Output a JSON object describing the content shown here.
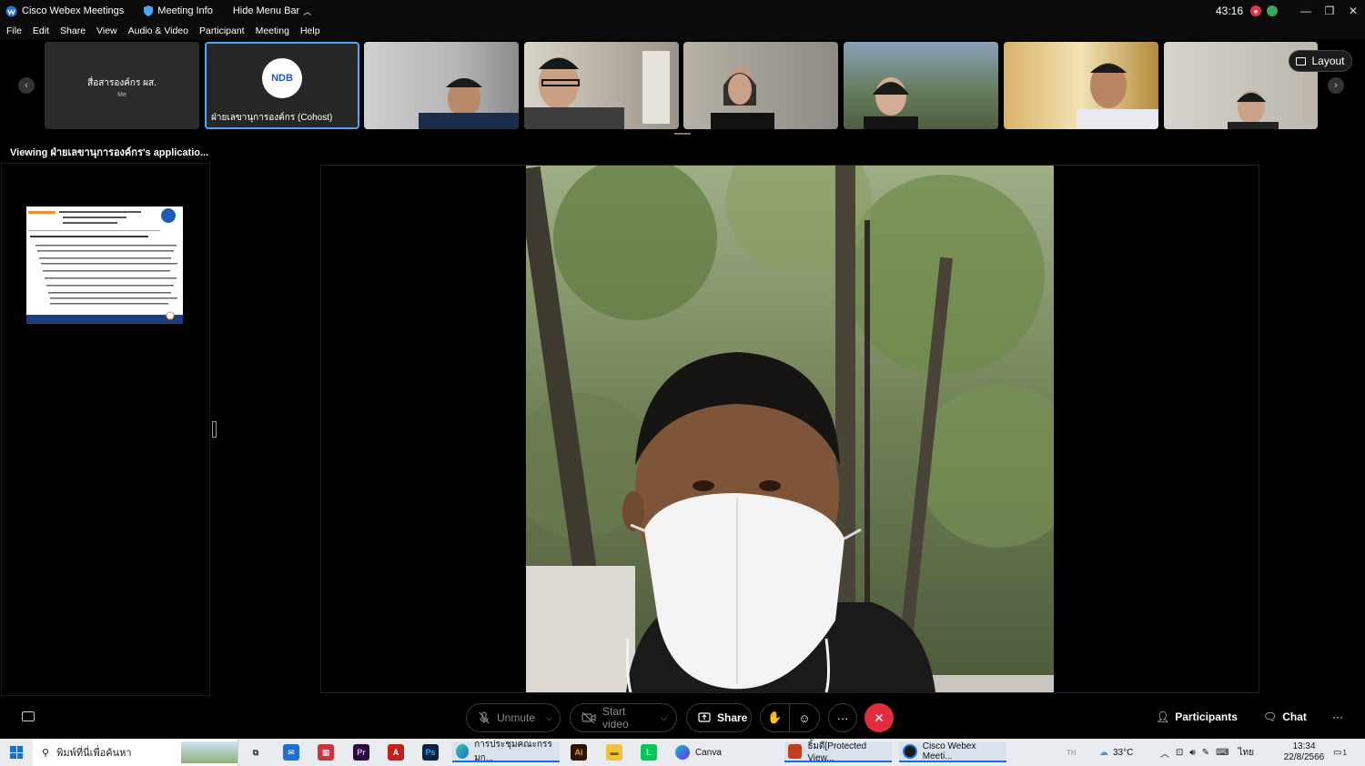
{
  "titlebar": {
    "app_name": "Cisco Webex Meetings",
    "meeting_info": "Meeting Info",
    "hide_menu": "Hide Menu Bar",
    "timer": "43:16"
  },
  "menu": [
    "File",
    "Edit",
    "Share",
    "View",
    "Audio & Video",
    "Participant",
    "Meeting",
    "Help"
  ],
  "participants": {
    "me_name": "สื่อสารองค์กร ผส.",
    "me_sub": "Me",
    "cohost_name": "ฝ่ายเลขานุการองค์กร (Cohost)",
    "logo_text": "NDB"
  },
  "layout_label": "Layout",
  "viewing_text": "Viewing ฝ่ายเลขานุการองค์กร's applicatio...",
  "controls": {
    "unmute": "Unmute",
    "start_video": "Start video",
    "share": "Share",
    "more": "···",
    "participants": "Participants",
    "chat": "Chat",
    "overflow": "···"
  },
  "taskbar": {
    "search_placeholder": "พิมพ์ที่นี่เพื่อค้นหา",
    "apps": {
      "edge_doc": "การประชุมคณะกรรมก...",
      "canva": "Canva",
      "ppt": "ธิ้มดี[Protected View...",
      "webex": "Cisco Webex Meeti..."
    },
    "lang_indicator": "TH",
    "temperature": "33°C",
    "ime": "ไทย",
    "time": "13:34",
    "date": "22/8/2566",
    "notification_count": "1"
  },
  "colors": {
    "accent": "#4aa6ff",
    "end_call": "#e02c3c",
    "record": "#e3384b"
  }
}
